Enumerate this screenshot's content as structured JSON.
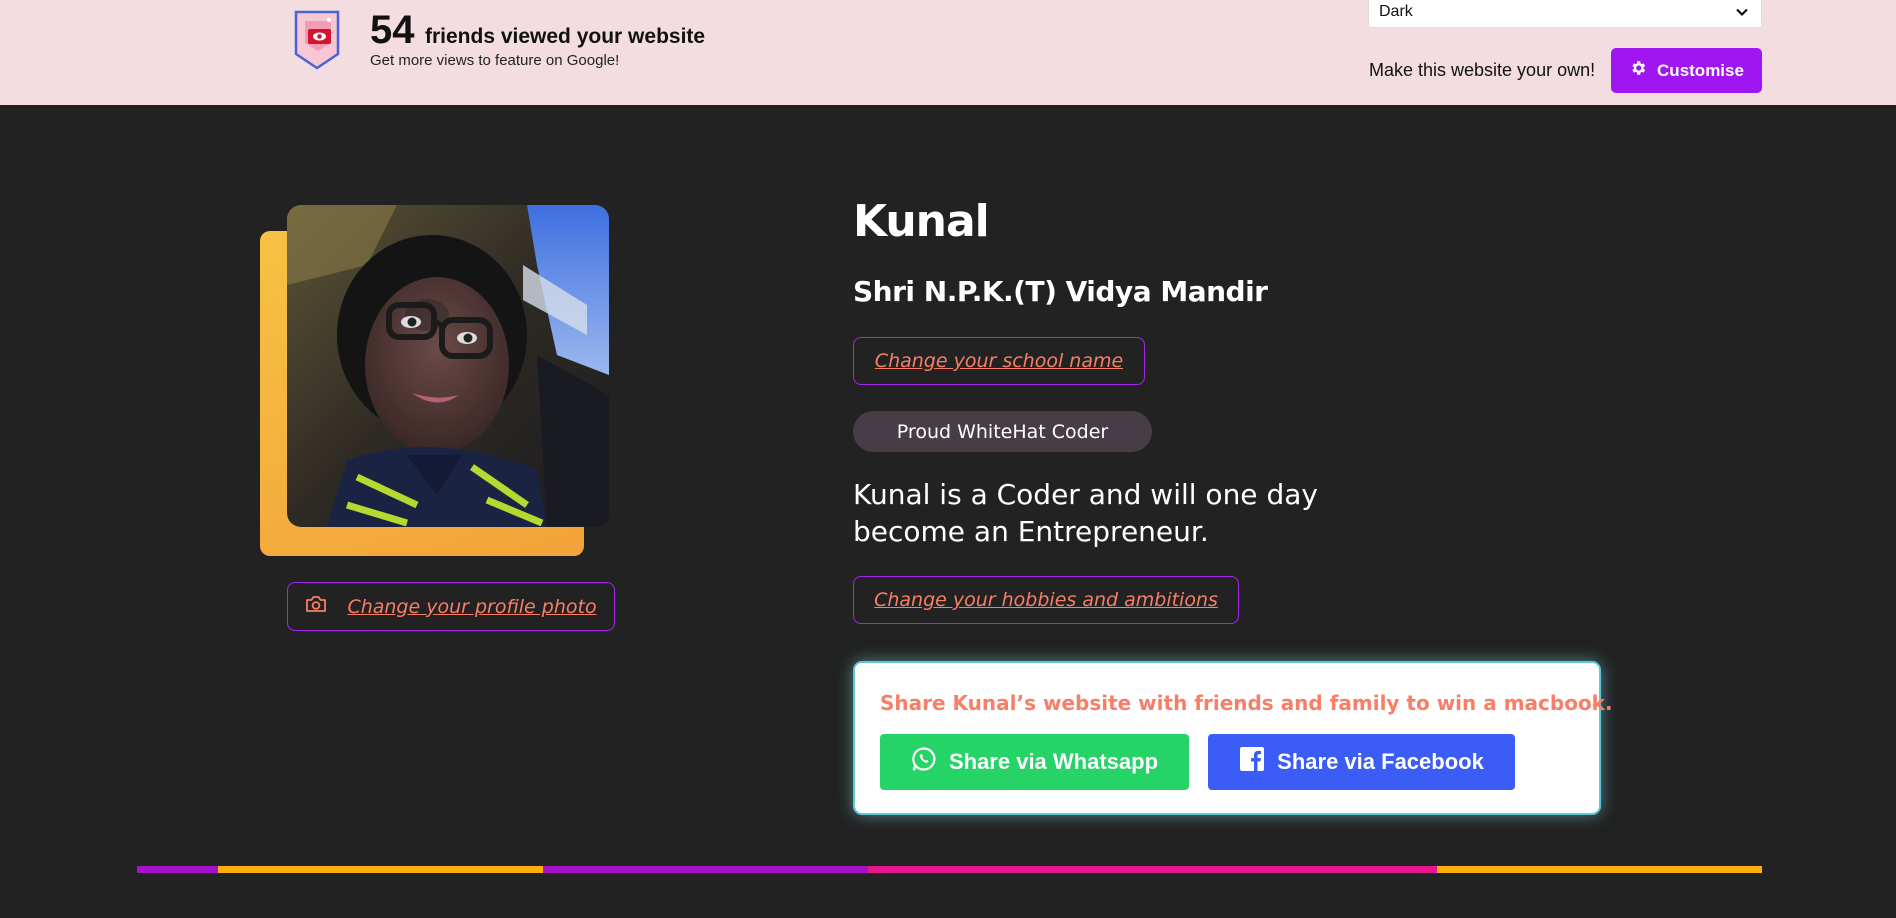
{
  "header": {
    "views_count": "54",
    "views_text": "friends viewed your website",
    "views_subtext": "Get more views to feature on Google!",
    "theme_select_value": "Dark",
    "own_text": "Make this website your own!",
    "customise_label": "Customise"
  },
  "profile": {
    "name": "Kunal",
    "school": "Shri N.P.K.(T) Vidya Mandir",
    "change_school_label": "Change your school name",
    "change_photo_label": "Change your profile photo",
    "badge": "Proud WhiteHat Coder",
    "bio": "Kunal is a Coder and will one day become an Entrepreneur.",
    "change_hobbies_label": "Change your hobbies and ambitions"
  },
  "share": {
    "message": "Share Kunal’s website with friends and family to win a macbook.",
    "whatsapp_label": "Share via Whatsapp",
    "facebook_label": "Share via Facebook"
  },
  "colors": {
    "background": "#222222",
    "topbar": "#f3dde1",
    "accent_purple": "#a016f3",
    "link_coral": "#f87e67",
    "whatsapp_green": "#25d366",
    "facebook_blue": "#3b5cf5",
    "stripe": [
      "#a611c9",
      "#ffae0f",
      "#a611c9",
      "#e5168e",
      "#ffae0f"
    ]
  },
  "icons": [
    "views-badge-icon",
    "chevron-down-icon",
    "gear-icon",
    "camera-icon",
    "whatsapp-icon",
    "facebook-icon"
  ]
}
